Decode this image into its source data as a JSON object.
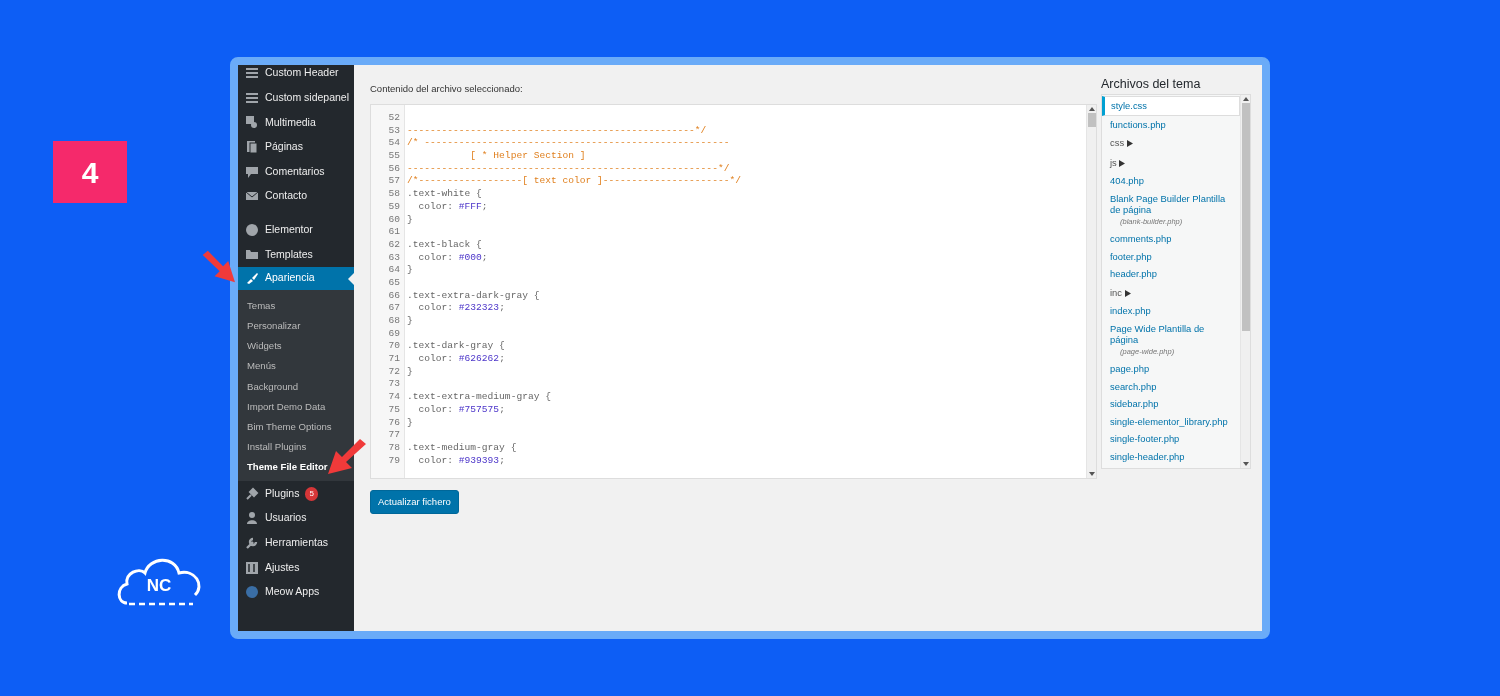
{
  "badge": "4",
  "logo": "NC",
  "sidebar": {
    "groups": [
      [
        {
          "label": "Custom Header",
          "selected": false
        },
        {
          "label": "Custom sidepanel",
          "selected": false
        },
        {
          "label": "Multimedia",
          "selected": false
        },
        {
          "label": "Páginas",
          "selected": false
        },
        {
          "label": "Comentarios",
          "selected": false
        },
        {
          "label": "Contacto",
          "selected": false
        }
      ],
      [
        {
          "label": "Elementor",
          "selected": false
        },
        {
          "label": "Templates",
          "selected": false
        },
        {
          "label": "Apariencia",
          "selected": true,
          "submenu": [
            {
              "label": "Temas",
              "selected": false
            },
            {
              "label": "Personalizar",
              "selected": false
            },
            {
              "label": "Widgets",
              "selected": false
            },
            {
              "label": "Menús",
              "selected": false
            },
            {
              "label": "Background",
              "selected": false
            },
            {
              "label": "Import Demo Data",
              "selected": false
            },
            {
              "label": "Bim Theme Options",
              "selected": false
            },
            {
              "label": "Install Plugins",
              "selected": false
            },
            {
              "label": "Theme File Editor",
              "selected": true
            }
          ]
        },
        {
          "label": "Plugins",
          "selected": false,
          "count": "5"
        },
        {
          "label": "Usuarios",
          "selected": false
        },
        {
          "label": "Herramientas",
          "selected": false
        },
        {
          "label": "Ajustes",
          "selected": false
        },
        {
          "label": "Meow Apps",
          "selected": false
        }
      ]
    ]
  },
  "editor": {
    "label": "Contenido del archivo seleccionado:",
    "lines": [
      {
        "n": "52",
        "kind": "blank"
      },
      {
        "n": "53",
        "kind": "comment",
        "text": "--------------------------------------------------*/"
      },
      {
        "n": "54",
        "kind": "comment",
        "text": "/* -----------------------------------------------------"
      },
      {
        "n": "55",
        "kind": "comment",
        "text": "           [ * Helper Section ]"
      },
      {
        "n": "56",
        "kind": "comment",
        "text": "------------------------------------------------------*/"
      },
      {
        "n": "57",
        "kind": "comment",
        "text": "/*------------------[ text color ]----------------------*/"
      },
      {
        "n": "58",
        "kind": "code",
        "text": ".text-white {"
      },
      {
        "n": "59",
        "kind": "property",
        "text": "  color: ",
        "value": "#FFF",
        "end": ";"
      },
      {
        "n": "60",
        "kind": "code",
        "text": "}"
      },
      {
        "n": "61",
        "kind": "blank"
      },
      {
        "n": "62",
        "kind": "code",
        "text": ".text-black {"
      },
      {
        "n": "63",
        "kind": "property",
        "text": "  color: ",
        "value": "#000",
        "end": ";"
      },
      {
        "n": "64",
        "kind": "code",
        "text": "}"
      },
      {
        "n": "65",
        "kind": "blank"
      },
      {
        "n": "66",
        "kind": "code",
        "text": ".text-extra-dark-gray {"
      },
      {
        "n": "67",
        "kind": "property",
        "text": "  color: ",
        "value": "#232323",
        "end": ";"
      },
      {
        "n": "68",
        "kind": "code",
        "text": "}"
      },
      {
        "n": "69",
        "kind": "blank"
      },
      {
        "n": "70",
        "kind": "code",
        "text": ".text-dark-gray {"
      },
      {
        "n": "71",
        "kind": "property",
        "text": "  color: ",
        "value": "#626262",
        "end": ";"
      },
      {
        "n": "72",
        "kind": "code",
        "text": "}"
      },
      {
        "n": "73",
        "kind": "blank"
      },
      {
        "n": "74",
        "kind": "code",
        "text": ".text-extra-medium-gray {"
      },
      {
        "n": "75",
        "kind": "property",
        "text": "  color: ",
        "value": "#757575",
        "end": ";"
      },
      {
        "n": "76",
        "kind": "code",
        "text": "}"
      },
      {
        "n": "77",
        "kind": "blank"
      },
      {
        "n": "78",
        "kind": "code",
        "text": ".text-medium-gray {"
      },
      {
        "n": "79",
        "kind": "property",
        "text": "  color: ",
        "value": "#939393",
        "end": ";"
      }
    ]
  },
  "update_button": "Actualizar fichero",
  "files": {
    "title": "Archivos del tema",
    "items": [
      {
        "label": "style.css",
        "kind": "file",
        "selected": true
      },
      {
        "label": "functions.php",
        "kind": "file",
        "selected": false
      },
      {
        "label": "css",
        "kind": "folder",
        "selected": false
      },
      {
        "label": "js",
        "kind": "folder",
        "selected": false
      },
      {
        "label": "404.php",
        "kind": "file",
        "selected": false
      },
      {
        "label": "Blank Page Builder Plantilla de página",
        "kind": "file",
        "selected": false,
        "note": "(blank-builder.php)"
      },
      {
        "label": "comments.php",
        "kind": "file",
        "selected": false
      },
      {
        "label": "footer.php",
        "kind": "file",
        "selected": false
      },
      {
        "label": "header.php",
        "kind": "file",
        "selected": false
      },
      {
        "label": "inc",
        "kind": "folder",
        "selected": false
      },
      {
        "label": "index.php",
        "kind": "file",
        "selected": false
      },
      {
        "label": "Page Wide Plantilla de página",
        "kind": "file",
        "selected": false,
        "note": "(page-wide.php)"
      },
      {
        "label": "page.php",
        "kind": "file",
        "selected": false
      },
      {
        "label": "search.php",
        "kind": "file",
        "selected": false
      },
      {
        "label": "sidebar.php",
        "kind": "file",
        "selected": false
      },
      {
        "label": "single-elementor_library.php",
        "kind": "file",
        "selected": false
      },
      {
        "label": "single-footer.php",
        "kind": "file",
        "selected": false
      },
      {
        "label": "single-header.php",
        "kind": "file",
        "selected": false
      }
    ]
  }
}
